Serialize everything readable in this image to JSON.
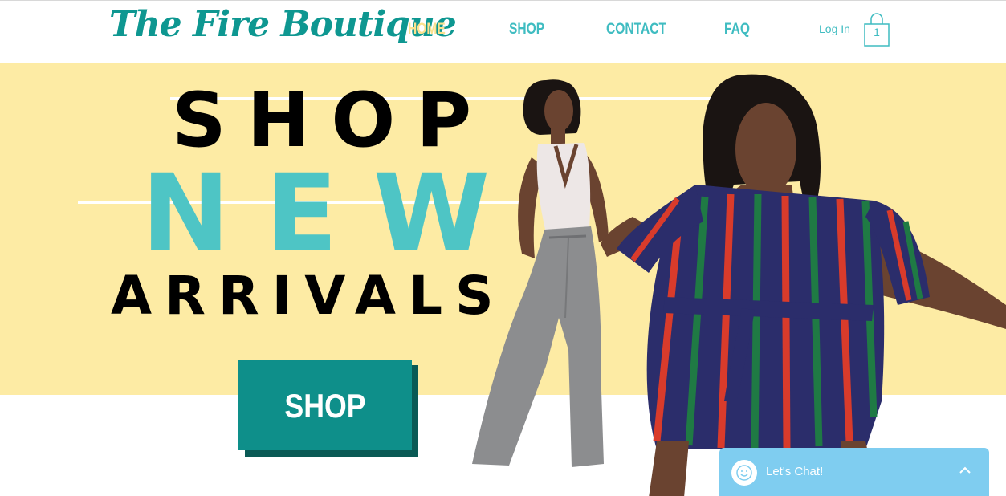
{
  "site": {
    "logo": "The Fire Boutique",
    "colors": {
      "accent": "#3fbcc1",
      "active": "#fbe28f",
      "band": "#fdeba4",
      "button": "#0e8f8a"
    }
  },
  "nav": {
    "items": [
      {
        "label": "HOME",
        "active": true
      },
      {
        "label": "SHOP",
        "active": false
      },
      {
        "label": "CONTACT",
        "active": false
      },
      {
        "label": "FAQ",
        "active": false
      }
    ],
    "login": "Log In",
    "cart_count": "1"
  },
  "hero": {
    "line1": "SHOP",
    "line2": "NEW",
    "line3": "ARRIVALS",
    "button": "SHOP"
  },
  "chat": {
    "label": "Let's Chat!",
    "icon": "chat-smiley-icon"
  }
}
